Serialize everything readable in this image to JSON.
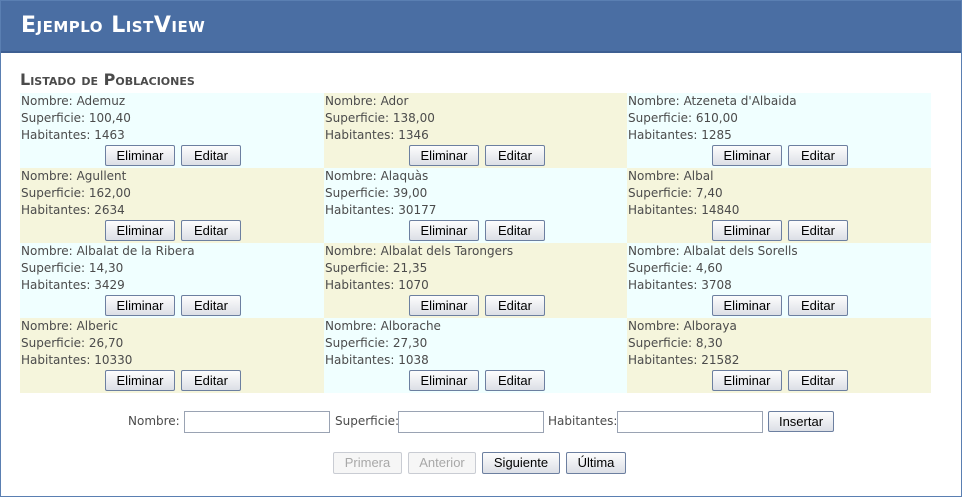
{
  "header": {
    "title": "Ejemplo ListView"
  },
  "section": {
    "title": "Listado de Poblaciones"
  },
  "labels": {
    "nombre": "Nombre:",
    "superficie": "Superficie:",
    "habitantes": "Habitantes:",
    "eliminar": "Eliminar",
    "editar": "Editar"
  },
  "colors": {
    "header": "#4a6ea3",
    "row_blue": "#f0ffff",
    "row_beige": "#f5f5dc"
  },
  "items": [
    {
      "nombre": "Ademuz",
      "superficie": "100,40",
      "habitantes": "1463"
    },
    {
      "nombre": "Ador",
      "superficie": "138,00",
      "habitantes": "1346"
    },
    {
      "nombre": "Atzeneta d'Albaida",
      "superficie": "610,00",
      "habitantes": "1285"
    },
    {
      "nombre": "Agullent",
      "superficie": "162,00",
      "habitantes": "2634"
    },
    {
      "nombre": "Alaquàs",
      "superficie": "39,00",
      "habitantes": "30177"
    },
    {
      "nombre": "Albal",
      "superficie": "7,40",
      "habitantes": "14840"
    },
    {
      "nombre": "Albalat de la Ribera",
      "superficie": "14,30",
      "habitantes": "3429"
    },
    {
      "nombre": "Albalat dels Tarongers",
      "superficie": "21,35",
      "habitantes": "1070"
    },
    {
      "nombre": "Albalat dels Sorells",
      "superficie": "4,60",
      "habitantes": "3708"
    },
    {
      "nombre": "Alberic",
      "superficie": "26,70",
      "habitantes": "10330"
    },
    {
      "nombre": "Alborache",
      "superficie": "27,30",
      "habitantes": "1038"
    },
    {
      "nombre": "Alboraya",
      "superficie": "8,30",
      "habitantes": "21582"
    }
  ],
  "insert_form": {
    "nombre_label": "Nombre:",
    "nombre_value": "",
    "superficie_label": "Superficie:",
    "superficie_value": "",
    "habitantes_label": "Habitantes:",
    "habitantes_value": "",
    "insert_button": "Insertar"
  },
  "pager": {
    "first": "Primera",
    "previous": "Anterior",
    "next": "Siguiente",
    "last": "Última"
  }
}
